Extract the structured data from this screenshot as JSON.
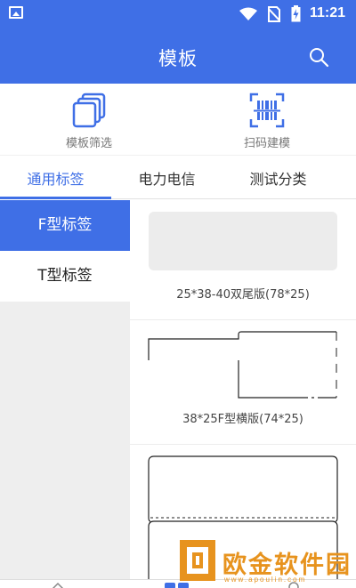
{
  "status_bar": {
    "time": "11:21",
    "icons": [
      "image-icon",
      "wifi-icon",
      "no-sim-icon",
      "battery-charging-icon"
    ]
  },
  "app_bar": {
    "title": "模板",
    "search_icon": "search-icon"
  },
  "quick_actions": [
    {
      "label": "模板筛选",
      "icon": "copy-stack-icon"
    },
    {
      "label": "扫码建模",
      "icon": "scan-barcode-icon"
    }
  ],
  "tabs": [
    {
      "label": "通用标签",
      "active": true
    },
    {
      "label": "电力电信",
      "active": false
    },
    {
      "label": "测试分类",
      "active": false
    }
  ],
  "sidebar": {
    "items": [
      {
        "label": "F型标签",
        "active": true
      },
      {
        "label": "T型标签",
        "active": false
      }
    ]
  },
  "templates": [
    {
      "caption": "25*38-40双尾版(78*25)"
    },
    {
      "caption": "38*25F型横版(74*25)"
    },
    {
      "caption": ""
    }
  ],
  "bottom_nav": [
    "home-icon",
    "grid-icon",
    "user-icon"
  ],
  "watermark": {
    "text": "欧金软件园",
    "url": "www.apoulin.com"
  },
  "colors": {
    "primary": "#3f6fe6",
    "sidebar_bg": "#eeeeee",
    "watermark": "#e7931e"
  }
}
